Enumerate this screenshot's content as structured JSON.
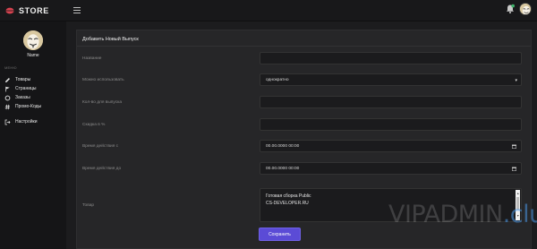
{
  "header": {
    "brand": "STORE",
    "brand_color": "#d94350",
    "icons": [
      "store-logo-icon",
      "menu-icon",
      "bell-icon",
      "avatar"
    ]
  },
  "sidebar": {
    "user_name": "Name",
    "section_label": "МЕНЮ",
    "items": [
      {
        "label": "Товары",
        "icon": "pencil-icon"
      },
      {
        "label": "Страницы",
        "icon": "flag-icon"
      },
      {
        "label": "Заказы",
        "icon": "circle-icon"
      },
      {
        "label": "Промо-Коды",
        "icon": "hash-icon"
      },
      {
        "label": "Настройки",
        "icon": "logout-icon"
      }
    ]
  },
  "form": {
    "title": "Добавить Новый Выпуск",
    "fields": {
      "name": {
        "label": "Название",
        "value": ""
      },
      "usage": {
        "label": "Можно использовать",
        "value": "однократно"
      },
      "count": {
        "label": "Кол-во для выпуска",
        "value": ""
      },
      "discount": {
        "label": "Скидка в %",
        "value": ""
      },
      "start": {
        "label": "Время действия с",
        "value": "00.00.0000 00:00"
      },
      "end": {
        "label": "Время действия до",
        "value": "00.00.0000 00:00"
      },
      "product": {
        "label": "Товар",
        "lines": [
          "Готовая сборка Public",
          "CS-DEVELOPER.RU"
        ]
      }
    },
    "save_label": "Сохранить",
    "accent_color": "#5b4bd6"
  },
  "watermark": {
    "main": "VIPADMIN",
    "accent": ".club"
  }
}
